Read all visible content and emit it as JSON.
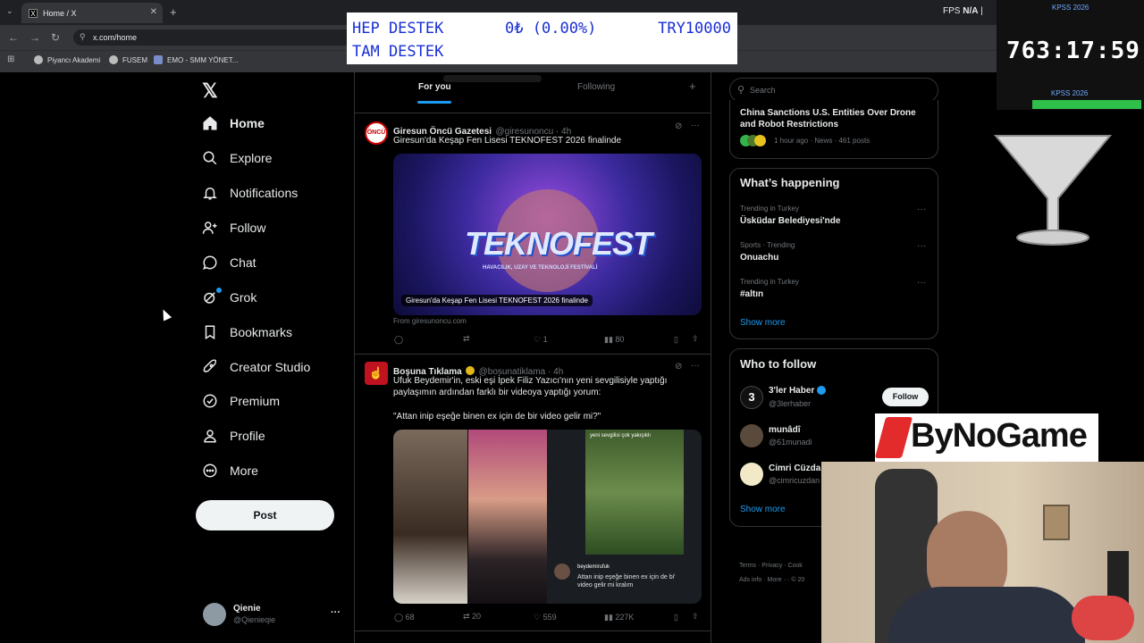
{
  "browser": {
    "tab_title": "Home / X",
    "url": "x.com/home",
    "bookmarks": [
      "Piyancı Akademi",
      "FUSEM",
      "EMO - SMM YÖNET..."
    ],
    "fps_label": "FPS",
    "fps_value": "N/A"
  },
  "overlay": {
    "row1_left": "HEP DESTEK",
    "row1_mid": "0₺ (0.00%)",
    "row1_right": "TRY10000",
    "row2_left": "TAM DESTEK",
    "kpss_label_top": "KPSS 2026",
    "kpss_timer": "763:17:59",
    "kpss_label_bottom": "KPSS 2026",
    "sponsor": "ByNoGame"
  },
  "sidebar": {
    "items": [
      {
        "label": "Home",
        "icon": "home-icon"
      },
      {
        "label": "Explore",
        "icon": "search-icon"
      },
      {
        "label": "Notifications",
        "icon": "bell-icon"
      },
      {
        "label": "Follow",
        "icon": "follow-icon"
      },
      {
        "label": "Chat",
        "icon": "chat-icon"
      },
      {
        "label": "Grok",
        "icon": "grok-icon"
      },
      {
        "label": "Bookmarks",
        "icon": "bookmark-icon"
      },
      {
        "label": "Creator Studio",
        "icon": "rocket-icon"
      },
      {
        "label": "Premium",
        "icon": "premium-icon"
      },
      {
        "label": "Profile",
        "icon": "person-icon"
      },
      {
        "label": "More",
        "icon": "more-icon"
      }
    ],
    "post_label": "Post",
    "account_name": "Qienie",
    "account_handle": "@Qienieqie",
    "account_more": "···"
  },
  "feed": {
    "tabs": [
      "For you",
      "Following"
    ],
    "tweets": [
      {
        "avatar_text": "ÖNCÜ",
        "name": "Giresun Öncü Gazetesi",
        "handle": "@giresunoncu · 4h",
        "text": "Giresun'da Keşap Fen Lisesi TEKNOFEST 2026 finalinde",
        "image_caption": "Giresun'da Keşap Fen Lisesi TEKNOFEST 2026 finalinde",
        "image_title": "TEKNOFEST",
        "image_sub": "HAVACILIK, UZAY VE TEKNOLOJİ FESTİVALİ",
        "source": "From giresunoncu.com",
        "replies": "",
        "reposts": "",
        "likes": "1",
        "views": "80"
      },
      {
        "name": "Boşuna Tıklama",
        "handle": "@bosunatiklama · 4h",
        "text1": "Ufuk Beydemir'in, eski eşi İpek Filiz Yazıcı'nın yeni sevgilisiyle yaptığı",
        "text2": "paylaşımın ardından farklı bir videoya yaptığı yorum:",
        "text3": "\"Attan inip eşeğe binen ex için de bir video gelir mi?\"",
        "media_overlay_top": "yeni sevgilisi çok yakışıklı",
        "media_user": "beydemirufuk",
        "media_comment1": "Attan inip eşeğe binen ex için de bi'",
        "media_comment2": "video gelir mi kralım",
        "replies": "68",
        "reposts": "20",
        "likes": "559",
        "views": "227K"
      }
    ]
  },
  "right": {
    "search_placeholder": "Search",
    "news_title1": "China Sanctions U.S. Entities Over Drone",
    "news_title2": "and Robot Restrictions",
    "news_meta": "1 hour ago · News · 461 posts",
    "happening_title": "What’s happening",
    "trends": [
      {
        "context": "Trending in Turkey",
        "name": "Üsküdar Belediyesi'nde"
      },
      {
        "context": "Sports · Trending",
        "name": "Onuachu"
      },
      {
        "context": "Trending in Turkey",
        "name": "#altın"
      }
    ],
    "show_more": "Show more",
    "who_title": "Who to follow",
    "follow": [
      {
        "name": "3'ler Haber",
        "handle": "@3lerhaber"
      },
      {
        "name": "munâdî",
        "handle": "@61munadi"
      },
      {
        "name": "Cimri Cüzdan",
        "handle": "@cimricuzdan"
      }
    ],
    "follow_btn": "Follow",
    "footer1": "Terms · Privacy · Cook",
    "footer2": "Ads info · More ··· © 20"
  }
}
